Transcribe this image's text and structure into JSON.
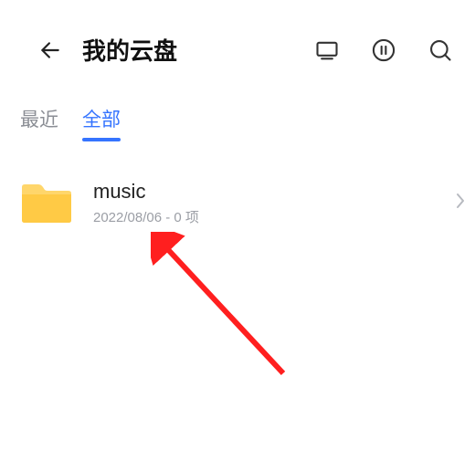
{
  "header": {
    "title": "我的云盘"
  },
  "tabs": {
    "recent": "最近",
    "all": "全部"
  },
  "folder": {
    "name": "music",
    "meta": "2022/08/06 - 0 项"
  }
}
